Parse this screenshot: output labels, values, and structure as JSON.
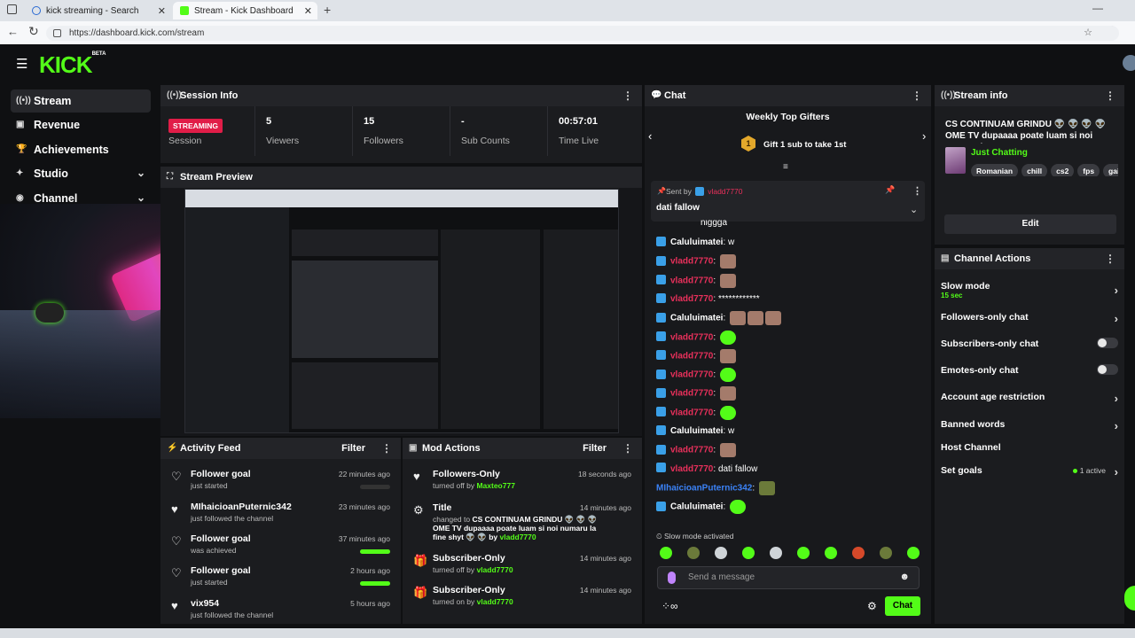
{
  "browser": {
    "tabs": [
      {
        "label": "kick streaming - Search"
      },
      {
        "label": "Stream - Kick Dashboard"
      }
    ],
    "url": "https://dashboard.kick.com/stream"
  },
  "app": {
    "logo": "KICK",
    "logo_suffix": "BETA",
    "sidebar": [
      {
        "label": "Stream"
      },
      {
        "label": "Revenue"
      },
      {
        "label": "Achievements"
      },
      {
        "label": "Studio"
      },
      {
        "label": "Channel"
      }
    ]
  },
  "session": {
    "title": "Session Info",
    "status_badge": "STREAMING",
    "status_label": "Session",
    "stats": [
      {
        "value": "5",
        "label": "Viewers"
      },
      {
        "value": "15",
        "label": "Followers"
      },
      {
        "value": "-",
        "label": "Sub Counts"
      },
      {
        "value": "00:57:01",
        "label": "Time Live"
      }
    ]
  },
  "preview": {
    "title": "Stream Preview"
  },
  "activity": {
    "title": "Activity Feed",
    "filter": "Filter",
    "items": [
      {
        "title": "Follower goal",
        "sub": "just started",
        "time": "22 minutes ago",
        "progress": 0
      },
      {
        "title": "MIhaicioanPuternic342",
        "sub": "just followed the channel",
        "time": "23 minutes ago"
      },
      {
        "title": "Follower goal",
        "sub": "was achieved",
        "time": "37 minutes ago",
        "progress": 1
      },
      {
        "title": "Follower goal",
        "sub": "just started",
        "time": "2 hours ago",
        "progress": 1
      },
      {
        "title": "vix954",
        "sub": "just followed the channel",
        "time": "5 hours ago"
      }
    ]
  },
  "mod": {
    "title": "Mod Actions",
    "filter": "Filter",
    "items": [
      {
        "title": "Followers-Only",
        "pre": "turned off by ",
        "by": "Maxteo777",
        "time": "18 seconds ago"
      },
      {
        "title": "Title",
        "pre": "changed to ",
        "change": "CS CONTINUAM GRINDU 👽 👽 👽 OME TV dupaaaa poate luam si noi numaru la fine shyt 👽 👽 by",
        "by": "vladd7770",
        "time": "14 minutes ago"
      },
      {
        "title": "Subscriber-Only",
        "pre": "turned off by ",
        "by": "vladd7770",
        "time": "14 minutes ago"
      },
      {
        "title": "Subscriber-Only",
        "pre": "turned on by ",
        "by": "vladd7770",
        "time": "14 minutes ago"
      }
    ]
  },
  "chat": {
    "title": "Chat",
    "gifters_title": "Weekly Top Gifters",
    "gifters_rank": "1",
    "gifters_cta": "Gift 1 sub to take 1st",
    "pinned_sent_by": "Sent by",
    "pinned_user": "vladd7770",
    "pinned_msg": "dati fallow",
    "cut_line": "niggga",
    "messages": [
      {
        "user": "Caluluimatei",
        "color": "#ffffff",
        "text": "w",
        "emotes": []
      },
      {
        "user": "vladd7770",
        "color": "#e8305b",
        "text": "",
        "emotes": [
          "face"
        ]
      },
      {
        "user": "vladd7770",
        "color": "#e8305b",
        "text": "",
        "emotes": [
          "face"
        ]
      },
      {
        "user": "vladd7770",
        "color": "#e8305b",
        "text": "************",
        "emotes": []
      },
      {
        "user": "Caluluimatei",
        "color": "#ffffff",
        "text": "",
        "emotes": [
          "face",
          "face",
          "face"
        ]
      },
      {
        "user": "vladd7770",
        "color": "#e8305b",
        "text": "",
        "emotes": [
          "green"
        ]
      },
      {
        "user": "vladd7770",
        "color": "#e8305b",
        "text": "",
        "emotes": [
          "face"
        ]
      },
      {
        "user": "vladd7770",
        "color": "#e8305b",
        "text": "",
        "emotes": [
          "green"
        ]
      },
      {
        "user": "vladd7770",
        "color": "#e8305b",
        "text": "",
        "emotes": [
          "face"
        ]
      },
      {
        "user": "vladd7770",
        "color": "#e8305b",
        "text": "",
        "emotes": [
          "green"
        ]
      },
      {
        "user": "Caluluimatei",
        "color": "#ffffff",
        "text": "w",
        "emotes": []
      },
      {
        "user": "vladd7770",
        "color": "#e8305b",
        "text": "",
        "emotes": [
          "face"
        ]
      },
      {
        "user": "vladd7770",
        "color": "#e8305b",
        "text": "dati fallow",
        "emotes": []
      },
      {
        "user": "MIhaicioanPuternic342",
        "color": "#3b82f6",
        "text": "",
        "emotes": [
          "olive"
        ],
        "nobadge": true
      },
      {
        "user": "Caluluimatei",
        "color": "#ffffff",
        "text": "",
        "emotes": [
          "green"
        ]
      }
    ],
    "slow_mode_note": "Slow mode activated",
    "input_placeholder": "Send a message",
    "send_label": "Chat"
  },
  "stream_info": {
    "title": "Stream info",
    "stream_title": "CS CONTINUAM GRINDU 👽 👽 👽 👽 OME TV dupaaaa poate luam si noi numaru l...",
    "category": "Just Chatting",
    "tags": [
      "Romanian",
      "chill",
      "cs2",
      "fps",
      "gai"
    ],
    "edit_label": "Edit"
  },
  "channel_actions": {
    "title": "Channel Actions",
    "slow_mode": "Slow mode",
    "slow_mode_sub": "15 sec",
    "followers_only": "Followers-only chat",
    "subscribers_only": "Subscribers-only chat",
    "emotes_only": "Emotes-only chat",
    "account_age": "Account age restriction",
    "banned_words": "Banned words",
    "host_channel": "Host Channel",
    "set_goals": "Set goals",
    "set_goals_badge": "1 active"
  },
  "colors": {
    "accent": "#53fc18",
    "live": "#e11d48",
    "mod_user": "#53fc18",
    "chat_red": "#e8305b"
  }
}
